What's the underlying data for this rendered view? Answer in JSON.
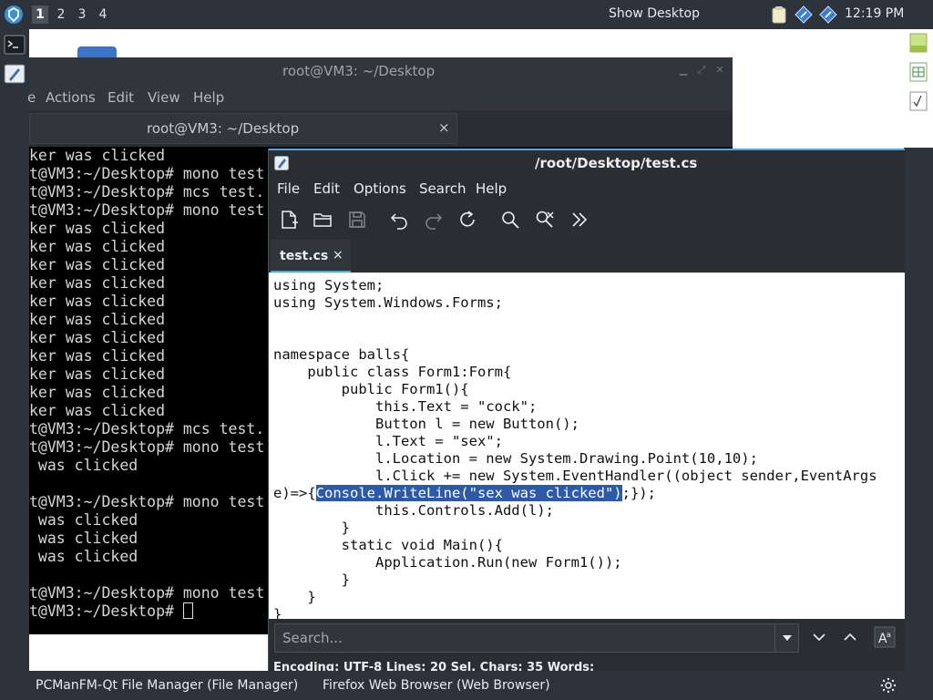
{
  "top_panel": {
    "workspaces": [
      "1",
      "2",
      "3",
      "4"
    ],
    "active_workspace": "1",
    "show_desktop": "Show Desktop",
    "clock": "12:19 PM"
  },
  "taskbar": {
    "items": [
      "PCManFM-Qt File Manager (File Manager)",
      "Firefox Web Browser (Web Browser)"
    ]
  },
  "terminal": {
    "title": "root@VM3: ~/Desktop",
    "menu": [
      "e",
      "Actions",
      "Edit",
      "View",
      "Help"
    ],
    "tab_label": "root@VM3: ~/Desktop",
    "tab_close": "×",
    "lines": [
      "ker was clicked",
      "t@VM3:~/Desktop# mono test",
      "t@VM3:~/Desktop# mcs test.",
      "t@VM3:~/Desktop# mono test",
      "ker was clicked",
      "ker was clicked",
      "ker was clicked",
      "ker was clicked",
      "ker was clicked",
      "ker was clicked",
      "ker was clicked",
      "ker was clicked",
      "ker was clicked",
      "ker was clicked",
      "ker was clicked",
      "t@VM3:~/Desktop# mcs test.",
      "t@VM3:~/Desktop# mono test",
      " was clicked",
      "",
      "t@VM3:~/Desktop# mono test",
      " was clicked",
      " was clicked",
      " was clicked",
      "",
      "t@VM3:~/Desktop# mono test",
      "t@VM3:~/Desktop# "
    ]
  },
  "editor": {
    "title": "/root/Desktop/test.cs",
    "menu": [
      "File",
      "Edit",
      "Options",
      "Search",
      "Help"
    ],
    "tab_label": "test.cs",
    "tab_close": "×",
    "code_lines": [
      "using System;",
      "using System.Windows.Forms;",
      "",
      "",
      "namespace balls{",
      "    public class Form1:Form{",
      "        public Form1(){",
      "            this.Text = \"cock\";",
      "            Button l = new Button();",
      "            l.Text = \"sex\";",
      "            l.Location = new System.Drawing.Point(10,10);",
      "            l.Click += new System.EventHandler((object sender,EventArgs",
      "SPLIT",
      "            this.Controls.Add(l);",
      "        }",
      "        static void Main(){",
      "            Application.Run(new Form1());",
      "        }",
      "    }",
      "}"
    ],
    "selected_line": {
      "before": "e)=>{",
      "selected": "Console.WriteLine(\"sex was clicked\")",
      "after": ";});"
    },
    "search_placeholder": "Search...",
    "status": "Encoding: UTF-8  Lines: 20  Sel. Chars: 35  Words:"
  }
}
